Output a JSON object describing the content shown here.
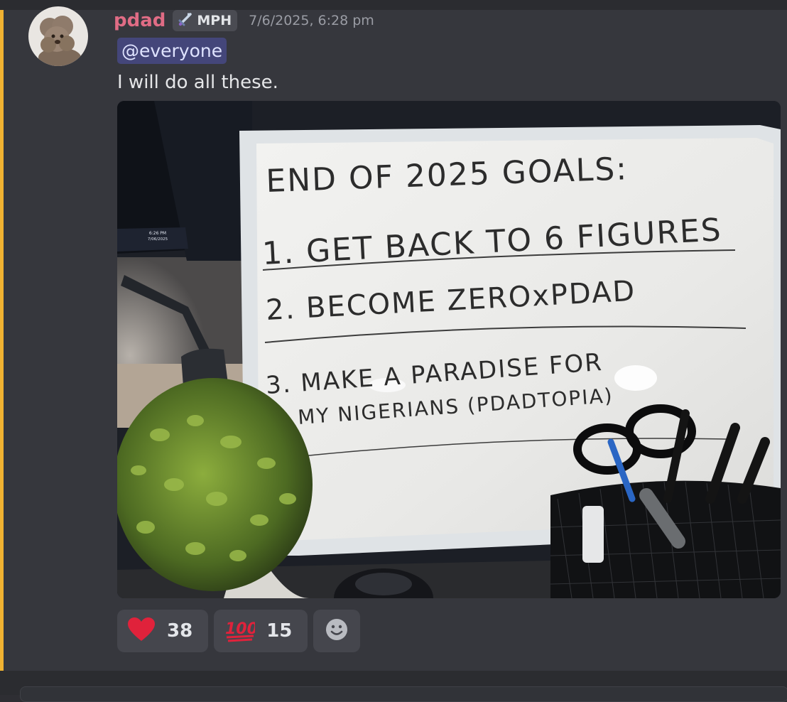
{
  "message": {
    "author": "pdad",
    "role_tag": "MPH",
    "role_icon": "sword-icon",
    "timestamp": "7/6/2025, 6:28 pm",
    "mention": "@everyone",
    "text": "I will do all these.",
    "accent_color": "#f0b232",
    "author_color": "#e06c85"
  },
  "attachment": {
    "whiteboard": {
      "line1": "END OF 2025 GOALS:",
      "line2": "1. GET BACK TO 6 FIGURES",
      "line3": "2. BECOME ZEROxPDAD",
      "line4a": "3. MAKE A PARADISE FOR",
      "line4b": "MY NIGERIANS (PDADTOPIA)"
    },
    "monitor": {
      "time": "6:26 PM",
      "date": "7/06/2025"
    }
  },
  "reactions": [
    {
      "emoji": "heart-icon",
      "count": "38"
    },
    {
      "emoji": "hundred-points-icon",
      "count": "15"
    }
  ],
  "add_reaction_icon": "smiley-add-icon"
}
